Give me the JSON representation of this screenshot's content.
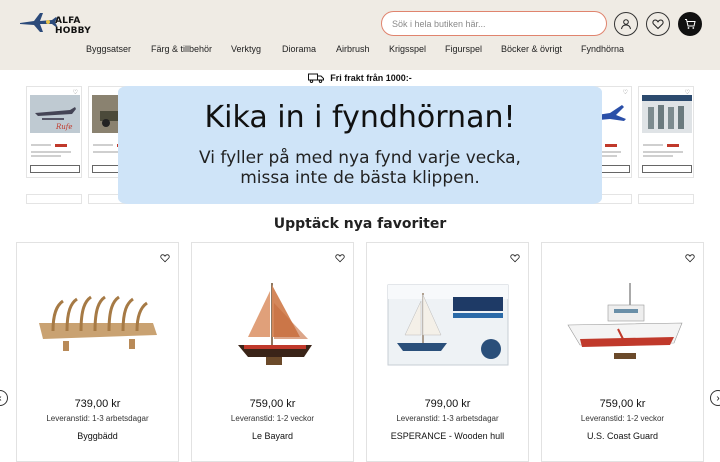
{
  "header": {
    "logo_text": "ALFA HOBBY",
    "search_placeholder": "Sök i hela butiken här...",
    "icons": [
      "user-icon",
      "heart-icon",
      "cart-icon"
    ],
    "background": "#efebe4",
    "search_border": "#e0846e"
  },
  "nav": {
    "items": [
      {
        "label": "Byggsatser"
      },
      {
        "label": "Färg & tillbehör"
      },
      {
        "label": "Verktyg"
      },
      {
        "label": "Diorama"
      },
      {
        "label": "Airbrush"
      },
      {
        "label": "Krigsspel"
      },
      {
        "label": "Figurspel"
      },
      {
        "label": "Böcker & övrigt"
      },
      {
        "label": "Fyndhörna"
      }
    ]
  },
  "shipping": {
    "text": "Fri frakt från 1000:-",
    "icon": "truck-icon"
  },
  "banner": {
    "title": "Kika in i fyndhörnan!",
    "subtitle_line1": "Vi fyller på med nya fynd varje vecka,",
    "subtitle_line2": "missa inte de bästa klippen.",
    "color": "#cfe4f8"
  },
  "section": {
    "title": "Upptäck nya favoriter"
  },
  "products": [
    {
      "price": "739,00 kr",
      "lead_time": "Leveranstid: 1-3 arbetsdagar",
      "name": "Byggbädd",
      "icon": "ship-frame-image"
    },
    {
      "price": "759,00 kr",
      "lead_time": "Leveranstid: 1-2 veckor",
      "name": "Le Bayard",
      "icon": "sailboat-image"
    },
    {
      "price": "799,00 kr",
      "lead_time": "Leveranstid: 1-3 arbetsdagar",
      "name": "ESPERANCE - Wooden hull",
      "icon": "boxed-sailboat-image"
    },
    {
      "price": "759,00 kr",
      "lead_time": "Leveranstid: 1-2 veckor",
      "name": "U.S. Coast Guard",
      "icon": "coast-guard-boat-image"
    }
  ]
}
